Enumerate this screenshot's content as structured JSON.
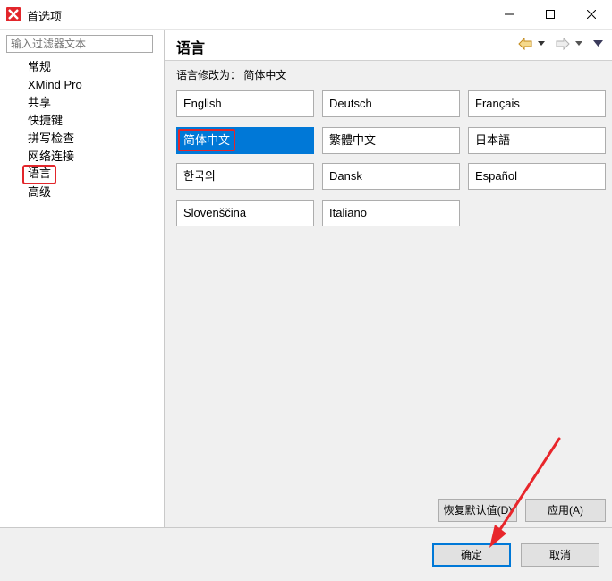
{
  "window": {
    "title": "首选项",
    "colors": {
      "logo": "#e2262b",
      "selection": "#0078d7",
      "highlight_box": "#e2262b"
    }
  },
  "sidebar": {
    "filter_placeholder": "输入过滤器文本",
    "items": [
      {
        "label": "常规"
      },
      {
        "label": "XMind Pro"
      },
      {
        "label": "共享"
      },
      {
        "label": "快捷键"
      },
      {
        "label": "拼写检查"
      },
      {
        "label": "网络连接"
      },
      {
        "label": "语言",
        "selected": true
      },
      {
        "label": "高级"
      }
    ]
  },
  "page": {
    "title": "语言",
    "lang_label": "语言修改为：  简体中文",
    "languages": [
      {
        "label": "English"
      },
      {
        "label": "Deutsch"
      },
      {
        "label": "Français"
      },
      {
        "label": "简体中文",
        "selected": true
      },
      {
        "label": "繁體中文"
      },
      {
        "label": "日本語"
      },
      {
        "label": "한국의"
      },
      {
        "label": "Dansk"
      },
      {
        "label": "Español"
      },
      {
        "label": "Slovenščina"
      },
      {
        "label": "Italiano"
      }
    ],
    "restore_defaults_label": "恢复默认值(D)",
    "apply_label": "应用(A)",
    "nav_icons": [
      "back-arrow-icon",
      "dropdown-icon",
      "forward-arrow-icon",
      "dropdown-icon",
      "view-menu-icon"
    ]
  },
  "footer": {
    "ok_label": "确定",
    "cancel_label": "取消"
  }
}
